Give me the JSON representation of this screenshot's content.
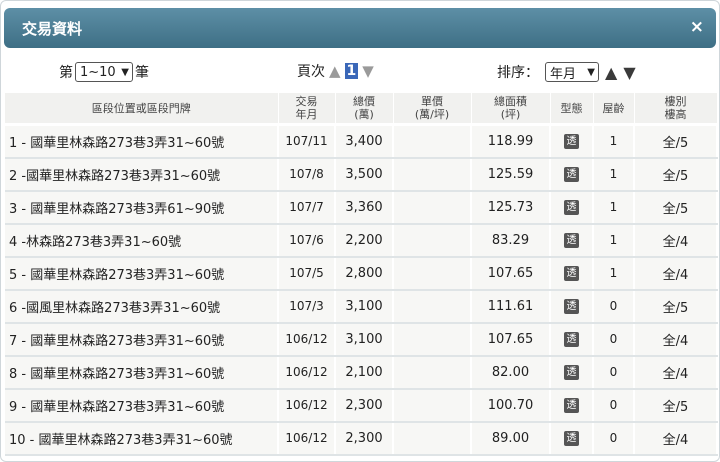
{
  "dialog": {
    "title": "交易資料",
    "close_glyph": "×"
  },
  "controls": {
    "per_page_prefix": "第",
    "per_page_value": "1~10",
    "per_page_suffix": "筆",
    "page_label": "頁次",
    "page_current": "1",
    "sort_label": "排序：",
    "sort_value": "年月",
    "up_arrow": "▲",
    "down_arrow": "▼"
  },
  "table": {
    "headers": [
      "區段位置或區段門牌",
      "交易\n年月",
      "總價\n(萬)",
      "單價\n(萬/坪)",
      "總面積\n(坪)",
      "型態",
      "屋齡",
      "樓別\n樓高"
    ],
    "rows": [
      {
        "addr": "1 - 國華里林森路273巷3弄31~60號",
        "ym": "107/11",
        "total": "3,400",
        "unit": "",
        "area": "118.99",
        "type": "透",
        "age": "1",
        "floor": "全/5"
      },
      {
        "addr": "2 -國華里林森路273巷3弄31~60號",
        "ym": "107/8",
        "total": "3,500",
        "unit": "",
        "area": "125.59",
        "type": "透",
        "age": "1",
        "floor": "全/5"
      },
      {
        "addr": "3 - 國華里林森路273巷3弄61~90號",
        "ym": "107/7",
        "total": "3,360",
        "unit": "",
        "area": "125.73",
        "type": "透",
        "age": "1",
        "floor": "全/5"
      },
      {
        "addr": "4 -林森路273巷3弄31~60號",
        "ym": "107/6",
        "total": "2,200",
        "unit": "",
        "area": "83.29",
        "type": "透",
        "age": "1",
        "floor": "全/4"
      },
      {
        "addr": "5 - 國華里林森路273巷3弄31~60號",
        "ym": "107/5",
        "total": "2,800",
        "unit": "",
        "area": "107.65",
        "type": "透",
        "age": "1",
        "floor": "全/4"
      },
      {
        "addr": "6 -國風里林森路273巷3弄31~60號",
        "ym": "107/3",
        "total": "3,100",
        "unit": "",
        "area": "111.61",
        "type": "透",
        "age": "0",
        "floor": "全/5"
      },
      {
        "addr": "7 - 國華里林森路273巷3弄31~60號",
        "ym": "106/12",
        "total": "3,100",
        "unit": "",
        "area": "107.65",
        "type": "透",
        "age": "0",
        "floor": "全/4"
      },
      {
        "addr": "8 - 國華里林森路273巷3弄31~60號",
        "ym": "106/12",
        "total": "2,100",
        "unit": "",
        "area": "82.00",
        "type": "透",
        "age": "0",
        "floor": "全/4"
      },
      {
        "addr": "9 - 國華里林森路273巷3弄31~60號",
        "ym": "106/12",
        "total": "2,300",
        "unit": "",
        "area": "100.70",
        "type": "透",
        "age": "0",
        "floor": "全/5"
      },
      {
        "addr": "10 - 國華里林森路273巷3弄31~60號",
        "ym": "106/12",
        "total": "2,300",
        "unit": "",
        "area": "89.00",
        "type": "透",
        "age": "0",
        "floor": "全/4"
      }
    ]
  }
}
